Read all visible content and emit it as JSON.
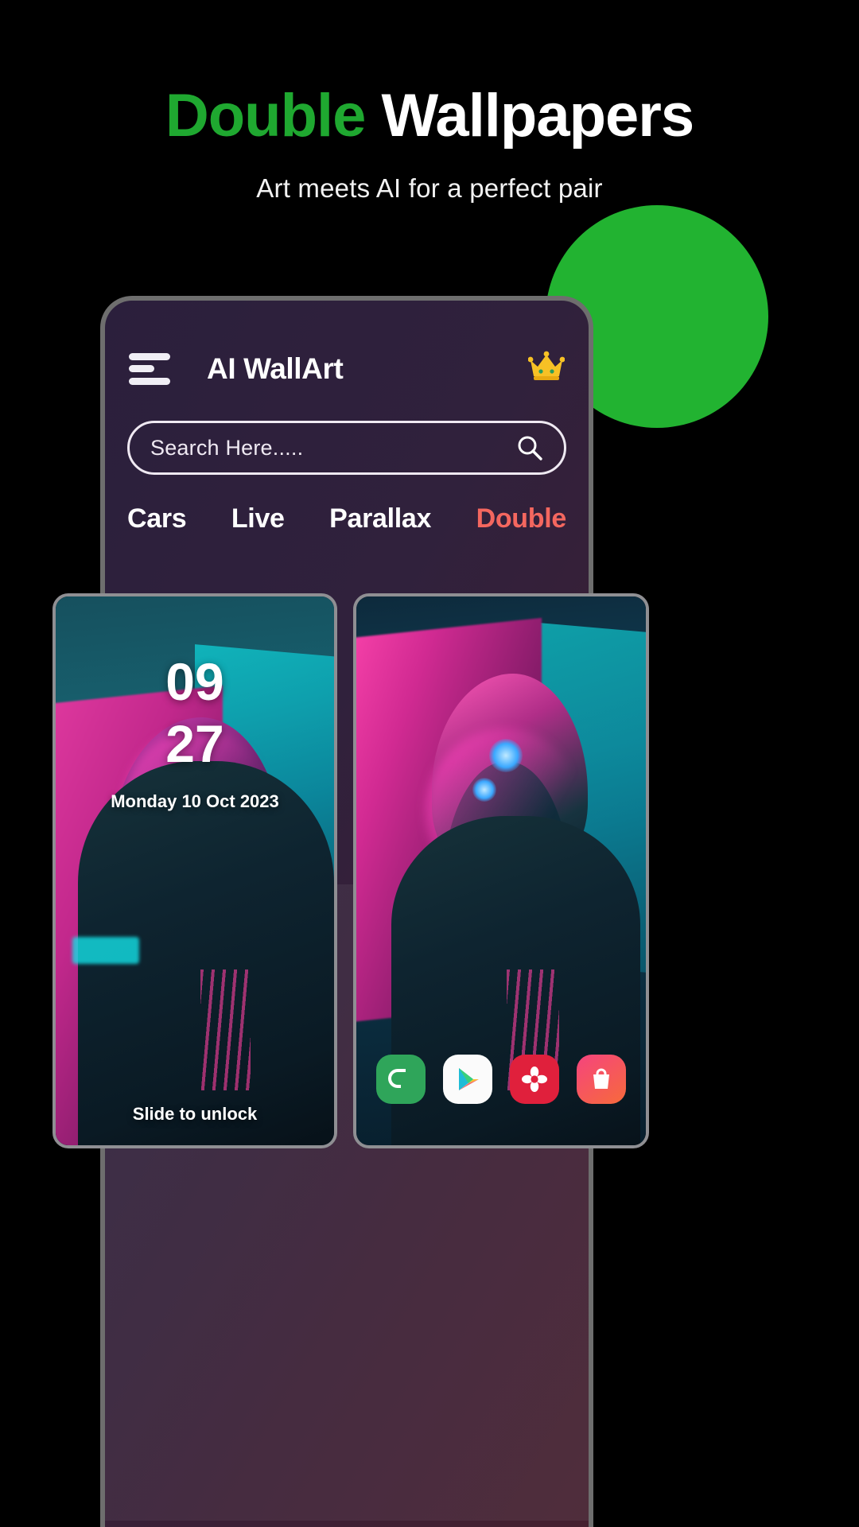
{
  "promo": {
    "headline_accent": "Double",
    "headline_rest": "Wallpapers",
    "subhead": "Art meets AI for a perfect pair",
    "accent_color": "#1fa830",
    "blob_color": "#22b331"
  },
  "app": {
    "title": "AI WallArt",
    "menu_icon": "hamburger-icon",
    "premium_icon": "crown-icon",
    "search": {
      "placeholder": "Search Here.....",
      "value": "",
      "icon": "search-icon"
    },
    "tabs": [
      {
        "label": "Cars",
        "active": false
      },
      {
        "label": "Live",
        "active": false
      },
      {
        "label": "Parallax",
        "active": false
      },
      {
        "label": "Double",
        "active": true
      }
    ],
    "active_tab_color": "#f4675f"
  },
  "preview": {
    "lockscreen": {
      "hours": "09",
      "minutes": "27",
      "date": "Monday 10 Oct 2023",
      "slide_hint": "Slide to unlock"
    },
    "homescreen": {
      "dock": [
        {
          "name": "phone-app-icon",
          "glyph": "C"
        },
        {
          "name": "play-store-app-icon",
          "glyph": "▶"
        },
        {
          "name": "photos-app-icon",
          "glyph": "✽"
        },
        {
          "name": "shop-app-icon",
          "glyph": "🛍"
        }
      ]
    }
  }
}
